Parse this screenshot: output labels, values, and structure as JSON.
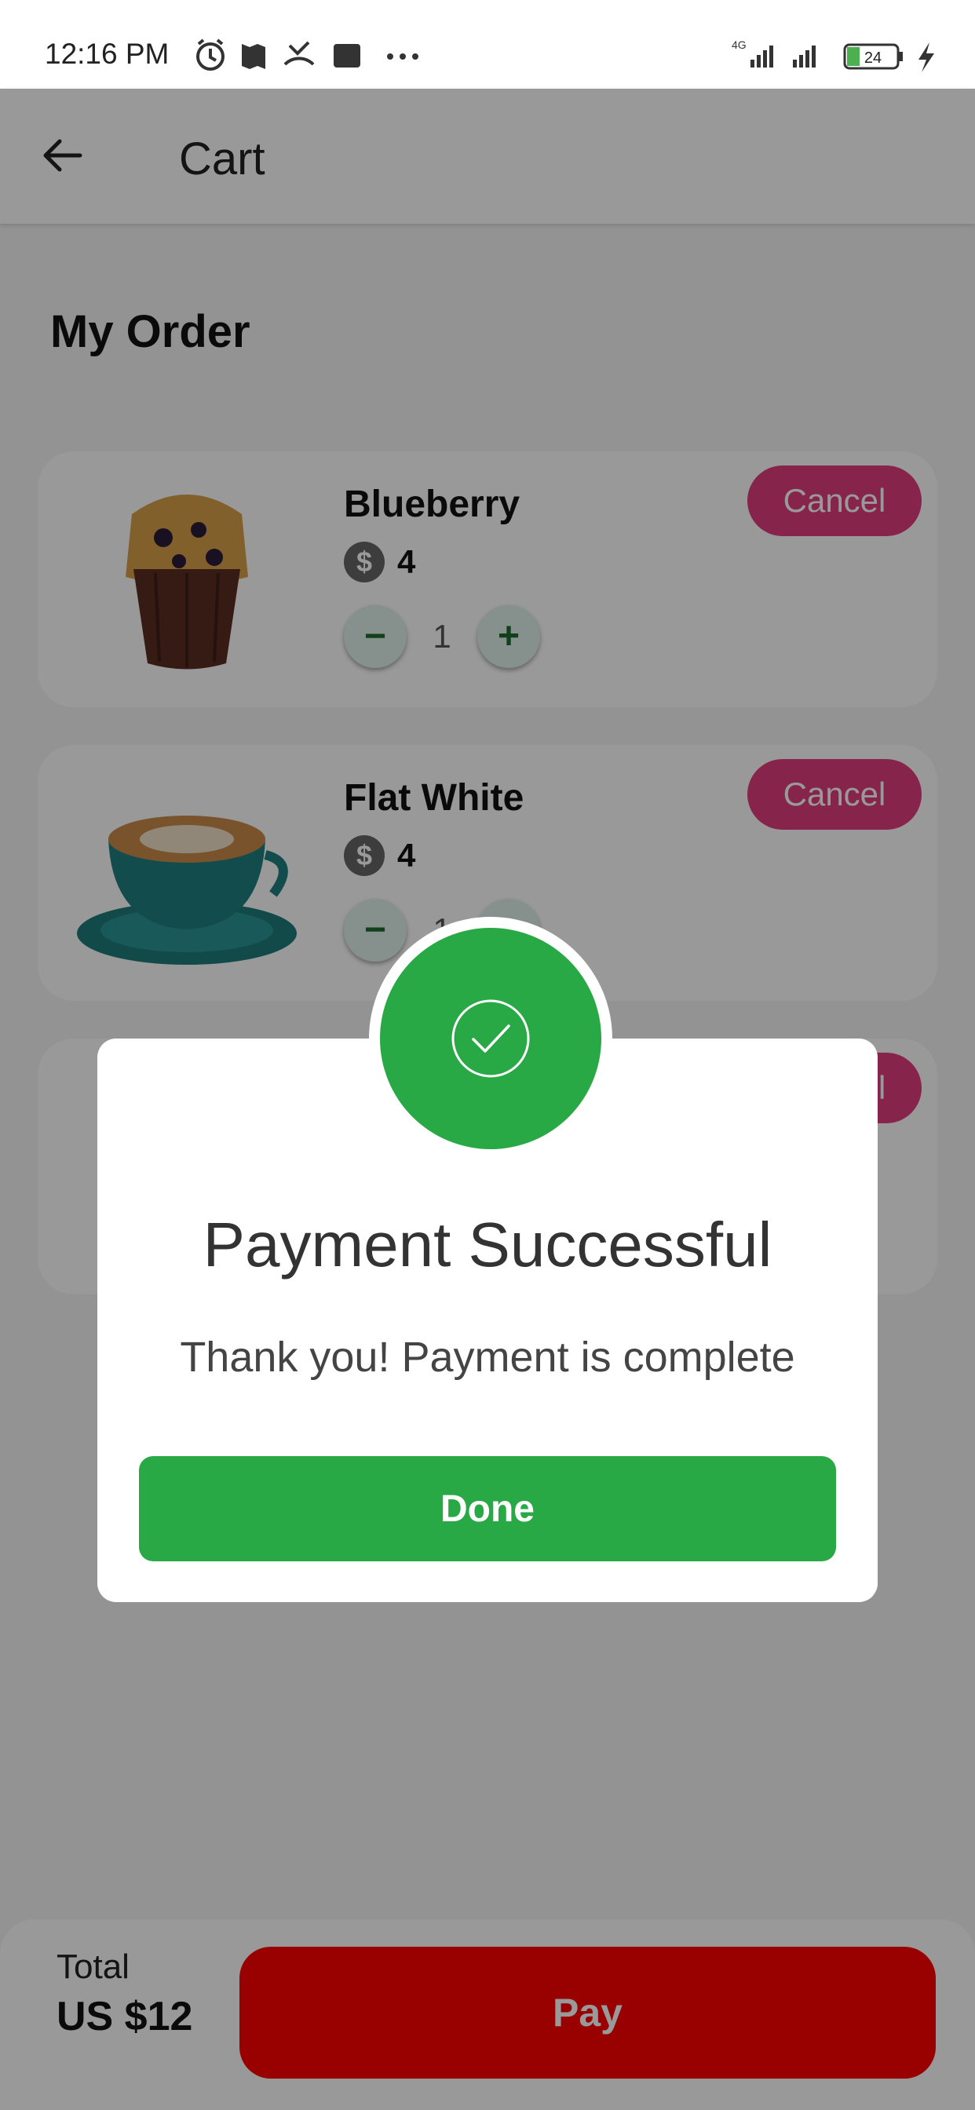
{
  "status_bar": {
    "time": "12:16 PM",
    "network_label": "4G",
    "battery": "24"
  },
  "header": {
    "title": "Cart"
  },
  "section": {
    "title": "My Order"
  },
  "items": [
    {
      "name": "Blueberry",
      "price": "4",
      "quantity": "1",
      "cancel_label": "Cancel"
    },
    {
      "name": "Flat White",
      "price": "4",
      "quantity": "1",
      "cancel_label": "Cancel"
    },
    {
      "cancel_label": "Cancel"
    }
  ],
  "footer": {
    "total_label": "Total",
    "total_value": "US $12",
    "pay_label": "Pay"
  },
  "dialog": {
    "title": "Payment Successful",
    "message": "Thank you! Payment is complete",
    "button_label": "Done"
  },
  "colors": {
    "success": "#29a846",
    "cancel": "#e23c7e",
    "pay": "#ff0000"
  }
}
